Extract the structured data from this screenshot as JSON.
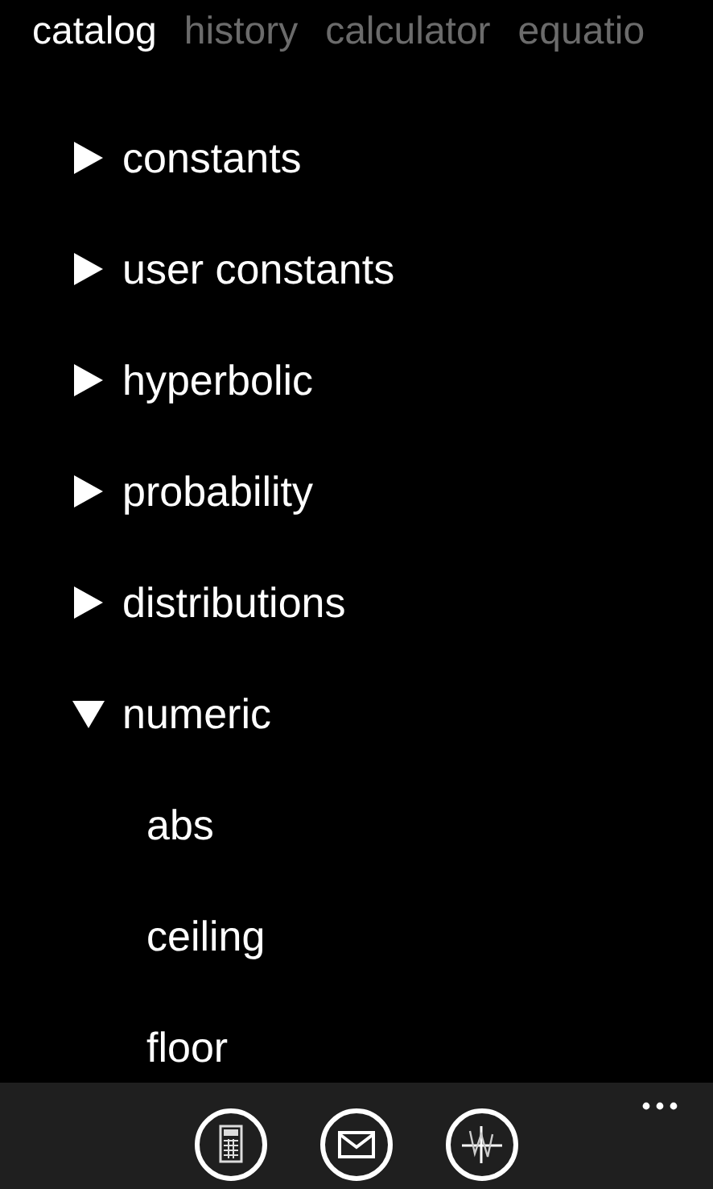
{
  "tabs": [
    {
      "label": "catalog",
      "selected": true
    },
    {
      "label": "history",
      "selected": false
    },
    {
      "label": "calculator",
      "selected": false
    },
    {
      "label": "equatio",
      "selected": false
    }
  ],
  "tree": [
    {
      "label": "constants",
      "expanded": false
    },
    {
      "label": "user constants",
      "expanded": false
    },
    {
      "label": "hyperbolic",
      "expanded": false
    },
    {
      "label": "probability",
      "expanded": false
    },
    {
      "label": "distributions",
      "expanded": false
    },
    {
      "label": "numeric",
      "expanded": true,
      "children": [
        {
          "label": "abs"
        },
        {
          "label": "ceiling"
        },
        {
          "label": "floor"
        }
      ]
    }
  ],
  "app_bar": {
    "buttons": [
      {
        "kind": "calculator"
      },
      {
        "kind": "mail"
      },
      {
        "kind": "graph"
      }
    ]
  }
}
